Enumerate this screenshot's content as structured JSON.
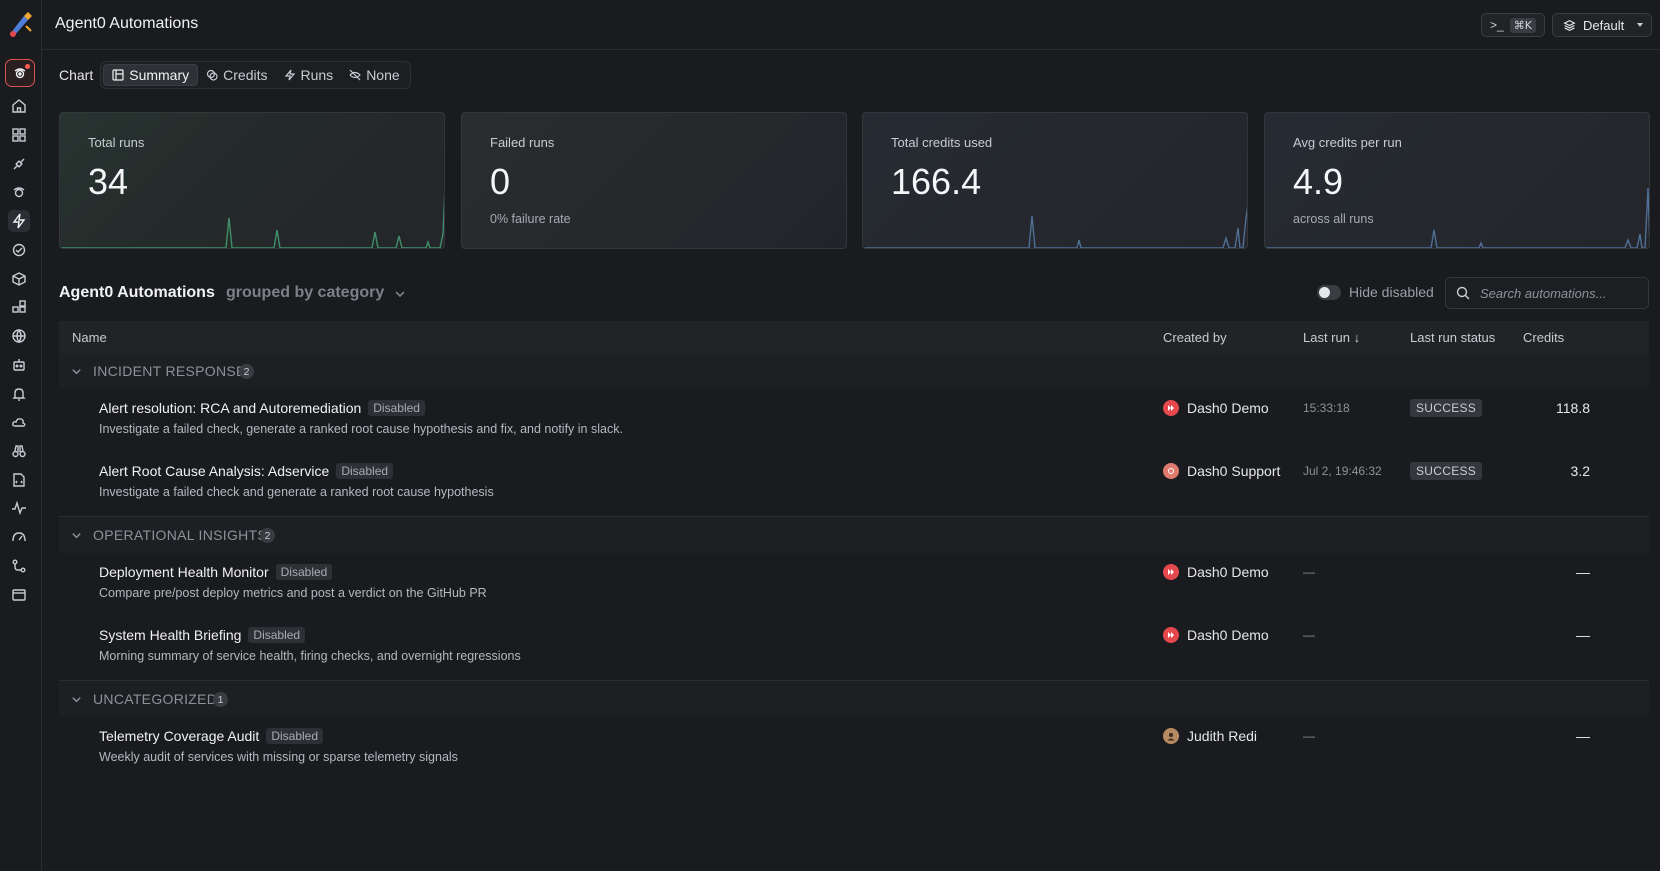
{
  "header": {
    "title": "Agent0 Automations",
    "cmd_shortcut": "⌘K",
    "workspace": "Default"
  },
  "chart_toggle": {
    "label": "Chart",
    "options": [
      {
        "label": "Summary",
        "icon": "summary-icon",
        "active": true
      },
      {
        "label": "Credits",
        "icon": "coins-icon",
        "active": false
      },
      {
        "label": "Runs",
        "icon": "bolt-icon",
        "active": false
      },
      {
        "label": "None",
        "icon": "eye-off-icon",
        "active": false
      }
    ]
  },
  "stats": [
    {
      "label": "Total runs",
      "value": "34",
      "sub": ""
    },
    {
      "label": "Failed runs",
      "value": "0",
      "sub": "0% failure rate"
    },
    {
      "label": "Total credits used",
      "value": "166.4",
      "sub": ""
    },
    {
      "label": "Avg credits per run",
      "value": "4.9",
      "sub": "across all runs"
    }
  ],
  "section": {
    "title": "Agent0 Automations",
    "grouping": "grouped by category",
    "hide_disabled_label": "Hide disabled",
    "search_placeholder": "Search automations..."
  },
  "table": {
    "columns": {
      "name": "Name",
      "created_by": "Created by",
      "last_run": "Last run",
      "status": "Last run status",
      "credits": "Credits"
    },
    "groups": [
      {
        "name": "INCIDENT RESPONSE",
        "count": "2",
        "rows": [
          {
            "name": "Alert resolution: RCA and Autoremediation",
            "badge": "Disabled",
            "desc": "Investigate a failed check, generate a ranked root cause hypothesis and fix, and notify in slack.",
            "creator": "Dash0 Demo",
            "last_run": "15:33:18",
            "status": "SUCCESS",
            "credits": "118.8"
          },
          {
            "name": "Alert Root Cause Analysis: Adservice",
            "badge": "Disabled",
            "desc": "Investigate a failed check and generate a ranked root cause hypothesis",
            "creator": "Dash0 Support",
            "last_run": "Jul 2, 19:46:32",
            "status": "SUCCESS",
            "credits": "3.2"
          }
        ]
      },
      {
        "name": "OPERATIONAL INSIGHTS",
        "count": "2",
        "rows": [
          {
            "name": "Deployment Health Monitor",
            "badge": "Disabled",
            "desc": "Compare pre/post deploy metrics and post a verdict on the GitHub PR",
            "creator": "Dash0 Demo",
            "last_run": "—",
            "status": "",
            "credits": "—"
          },
          {
            "name": "System Health Briefing",
            "badge": "Disabled",
            "desc": "Morning summary of service health, firing checks, and overnight regressions",
            "creator": "Dash0 Demo",
            "last_run": "—",
            "status": "",
            "credits": "—"
          }
        ]
      },
      {
        "name": "UNCATEGORIZED",
        "count": "1",
        "rows": [
          {
            "name": "Telemetry Coverage Audit",
            "badge": "Disabled",
            "desc": "Weekly audit of services with missing or sparse telemetry signals",
            "creator": "Judith Redi",
            "last_run": "—",
            "status": "",
            "credits": "—"
          }
        ]
      }
    ]
  },
  "colors": {
    "background": "#1a1b1e",
    "accent_red": "#e5484d",
    "sparkline_green": "#3f8f6a",
    "sparkline_blue": "#4f6f96"
  }
}
